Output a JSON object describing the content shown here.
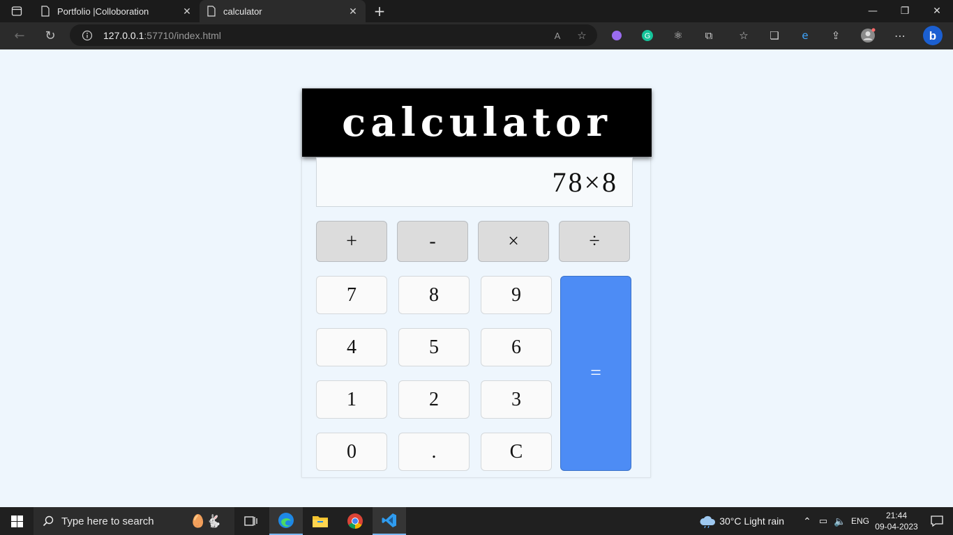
{
  "browser": {
    "tabs": [
      {
        "title": "Portfolio |Colloboration",
        "active": false
      },
      {
        "title": "calculator",
        "active": true
      }
    ],
    "address": {
      "host": "127.0.0.1",
      "path": ":57710/index.html"
    },
    "new_tab_label": "+"
  },
  "calculator": {
    "title": "calculator",
    "display": "78×8",
    "operators": [
      "+",
      "-",
      "×",
      "÷"
    ],
    "digits": [
      "7",
      "8",
      "9",
      "4",
      "5",
      "6",
      "1",
      "2",
      "3",
      "0",
      ".",
      "C"
    ],
    "equals": "="
  },
  "taskbar": {
    "search_placeholder": "Type here to search",
    "weather": "30°C  Light rain",
    "language": "ENG",
    "time": "21:44",
    "date": "09-04-2023"
  },
  "colors": {
    "accent": "#4d8cf5",
    "header": "#000000",
    "page_bg": "#eef6fd"
  }
}
